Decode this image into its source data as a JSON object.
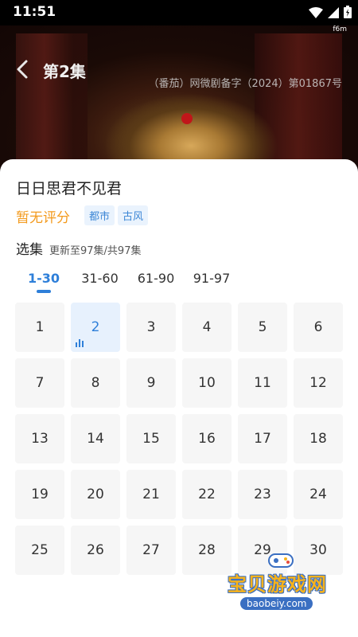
{
  "status_bar": {
    "time": "11:51",
    "sub_label": "f6m"
  },
  "video": {
    "episode_title": "第2集",
    "license": "（番茄）网微剧备字（2024）第01867号"
  },
  "sheet": {
    "drama_title": "日日思君不见君",
    "rating": "暂无评分",
    "tags": [
      "都市",
      "古风"
    ],
    "select_label": "选集",
    "update_info": "更新至97集/共97集",
    "ranges": [
      {
        "label": "1-30",
        "active": true
      },
      {
        "label": "31-60",
        "active": false
      },
      {
        "label": "61-90",
        "active": false
      },
      {
        "label": "91-97",
        "active": false
      }
    ],
    "current_episode": "2",
    "episodes": [
      "1",
      "2",
      "3",
      "4",
      "5",
      "6",
      "7",
      "8",
      "9",
      "10",
      "11",
      "12",
      "13",
      "14",
      "15",
      "16",
      "17",
      "18",
      "19",
      "20",
      "21",
      "22",
      "23",
      "24",
      "25",
      "26",
      "27",
      "28",
      "29",
      "30"
    ]
  },
  "watermark": {
    "text": "宝贝游戏网",
    "url": "baobeiy.com"
  },
  "colors": {
    "accent": "#2e7fd9",
    "rating": "#f39a1d",
    "tag_bg": "#eaf3fd"
  }
}
